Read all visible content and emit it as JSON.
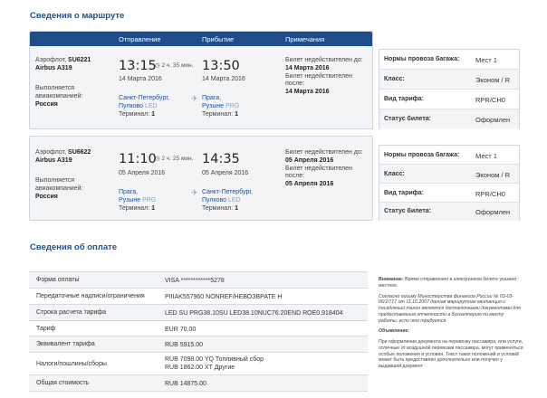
{
  "route_title": "Сведения о маршруте",
  "payment_title": "Сведения об оплате",
  "flight_headers": {
    "departure": "Отправление",
    "arrival": "Прибытие",
    "notes": "Примечания"
  },
  "flights": [
    {
      "airline": "Аэрофлот,",
      "flight_no": "SU6221",
      "aircraft": "Airbus A319",
      "operated_label": "Выполняется авиакомпанией:",
      "operator": "Россия",
      "dep_time": "13:15",
      "duration": "2 ч. 35 мин.",
      "dep_date": "14 Марта 2016",
      "arr_time": "13:50",
      "arr_date": "14 Марта 2016",
      "dep_city": "Санкт-Петербург,",
      "dep_airport": "Пулково",
      "dep_code": "LED",
      "dep_terminal_label": "Терминал:",
      "dep_terminal": "1",
      "arr_city": "Прага,",
      "arr_airport": "Рузыне",
      "arr_code": "PRG",
      "arr_terminal_label": "Терминал:",
      "arr_terminal": "1",
      "note_before_label": "Билет недействителен до:",
      "note_before": "14 Марта 2016",
      "note_after_label": "Билет недействителен после:",
      "note_after": "14 Марта 2016"
    },
    {
      "airline": "Аэрофлот,",
      "flight_no": "SU6622",
      "aircraft": "Airbus A319",
      "operated_label": "Выполняется авиакомпанией:",
      "operator": "Россия",
      "dep_time": "11:10",
      "duration": "2 ч. 25 мин.",
      "dep_date": "05 Апреля 2016",
      "arr_time": "14:35",
      "arr_date": "05 Апреля 2016",
      "dep_city": "Прага,",
      "dep_airport": "Рузыне",
      "dep_code": "PRG",
      "dep_terminal_label": "Терминал:",
      "dep_terminal": "1",
      "arr_city": "Санкт-Петербург,",
      "arr_airport": "Пулково",
      "arr_code": "LED",
      "arr_terminal_label": "Терминал:",
      "arr_terminal": "1",
      "note_before_label": "Билет недействителен до:",
      "note_before": "05 Апреля 2016",
      "note_after_label": "Билет недействителен после:",
      "note_after": "05 Апреля 2016"
    }
  ],
  "baggage": [
    {
      "rows": [
        {
          "k": "Нормы провоза багажа:",
          "v": "Мест 1"
        },
        {
          "k": "Класс:",
          "v": "Эконом / R"
        },
        {
          "k": "Вид тарифа:",
          "v": "RPR/CH0"
        },
        {
          "k": "Статус билета:",
          "v": "Оформлен"
        }
      ]
    },
    {
      "rows": [
        {
          "k": "Нормы провоза багажа:",
          "v": "Мест 1"
        },
        {
          "k": "Класс:",
          "v": "Эконом / R"
        },
        {
          "k": "Вид тарифа:",
          "v": "RPR/CH0"
        },
        {
          "k": "Статус билета:",
          "v": "Оформлен"
        }
      ]
    }
  ],
  "payment": [
    {
      "k": "Форма оплаты",
      "v": "VISA ************5278"
    },
    {
      "k": "Передаточные надписи/ограничения",
      "v": "PIIIAK557960 NONREF/НЕВОЗВРАТЕ Н"
    },
    {
      "k": "Строка расчета тарифа",
      "v": "LED SU PRG38.10SU LED38.10NUC76.20END ROE0.918404"
    },
    {
      "k": "Тариф",
      "v": "EUR 70.00"
    },
    {
      "k": "Эквивалент тарифа",
      "v": "RUB 5915.00"
    },
    {
      "k": "Налоги/пошлины/сборы",
      "v": "RUB 7098.00 YQ Топливный сбор",
      "v2": "RUB 1862.00 XT Другие"
    },
    {
      "k": "Общая стоимость",
      "v": "RUB 14875.00"
    }
  ],
  "notes": {
    "attention_label": "Внимание:",
    "attention": "Время отправления в электронном билете указано местное.",
    "letter": "Согласно письму Министерства финансов России № 03-03-06/1/717 от 11.10.2007 данная маршрутная квитанция и посадочный талон являются достаточными документами для предоставления отчетности в бухгалтерию по месту работы, если это требуется.",
    "announcement_label": "Объявление:",
    "announcement": "При оформлении документа на перевозку пассажира, или услуги, отличные от воздушной перевозки пассажира, могут применяться особые положения и условия. Текст таких положений и условий может быть предоставлен дополнительно или получен у выдавшей документ"
  },
  "icons": {
    "clock": "clock-icon",
    "plane": "plane-icon"
  },
  "colors": {
    "header_bg": "#1f4d8c",
    "title": "#1a4fa0",
    "row_shade": "#f3f4f6"
  }
}
